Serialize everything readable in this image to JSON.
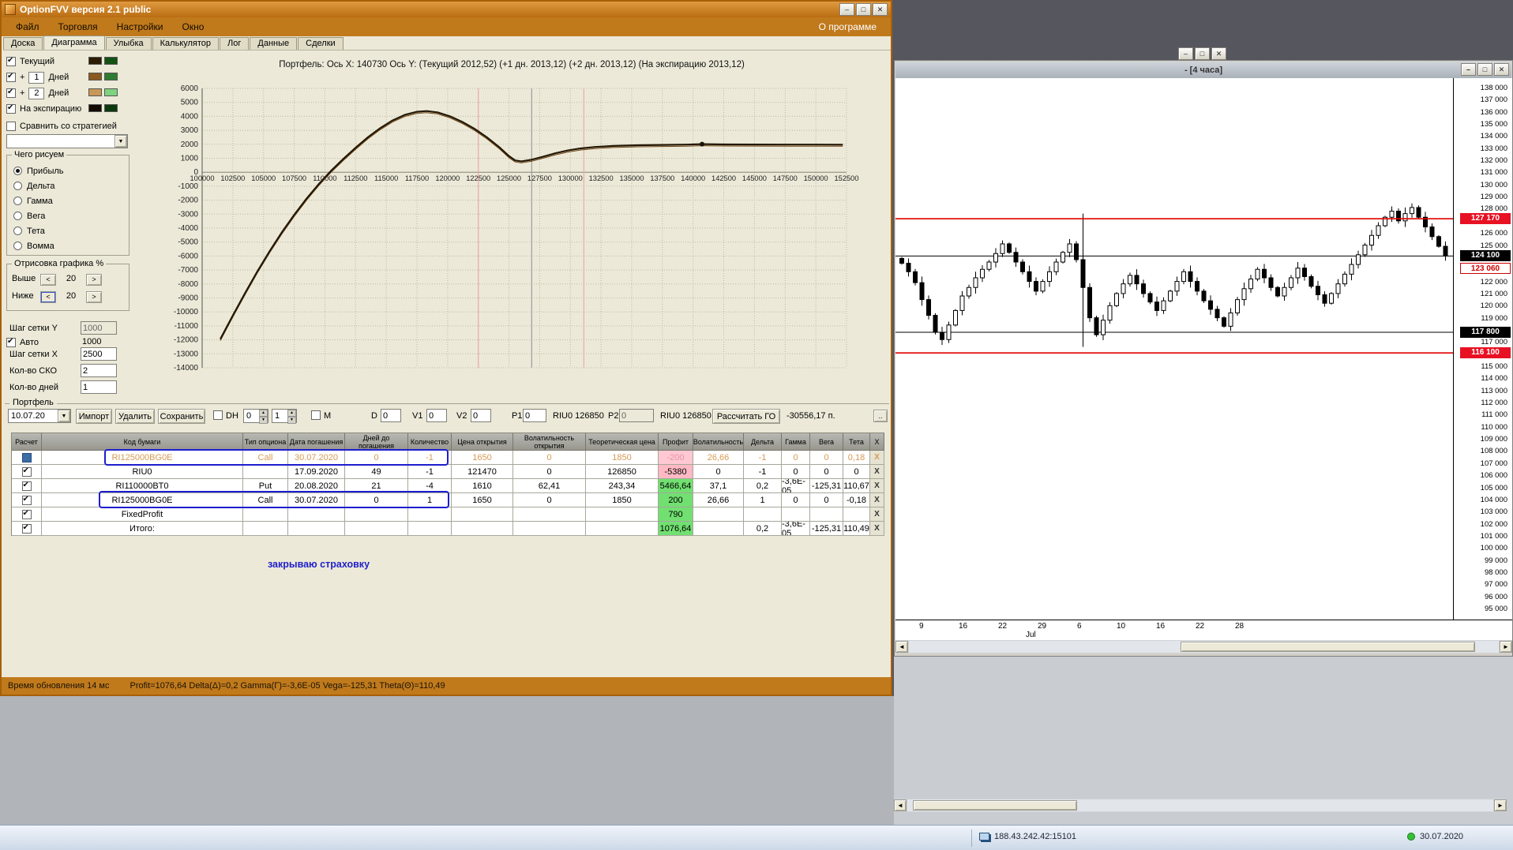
{
  "app": {
    "title": "OptionFVV версия 2.1 public",
    "menu": [
      "Файл",
      "Торговля",
      "Настройки",
      "Окно"
    ],
    "menu_right": "О программе",
    "tabs": [
      "Доска",
      "Диаграмма",
      "Улыбка",
      "Калькулятор",
      "Лог",
      "Данные",
      "Сделки"
    ],
    "active_tab": "Диаграмма"
  },
  "icons": {
    "minimize": "–",
    "maximize": "□",
    "close": "✕",
    "dropdown": "▼",
    "spin_up": "▲",
    "spin_down": "▼",
    "scroll_left": "◄",
    "scroll_right": "►",
    "step_left": "<",
    "step_right": ">"
  },
  "sidebar": {
    "legend": [
      {
        "label": "Текущий",
        "checked": true,
        "swatches": [
          "#2a1c02",
          "#145214"
        ]
      },
      {
        "prefix": "+",
        "value": "1",
        "suffix": "Дней",
        "checked": true,
        "swatches": [
          "#8a5a1e",
          "#2e7d32"
        ]
      },
      {
        "prefix": "+",
        "value": "2",
        "suffix": "Дней",
        "checked": true,
        "swatches": [
          "#c89858",
          "#7fd37f"
        ]
      },
      {
        "label": "На экспирацию",
        "checked": true,
        "swatches": [
          "#140c00",
          "#0c3a0c"
        ]
      }
    ],
    "compare_label": "Сравнить со стратегией",
    "draw_group": {
      "title": "Чего рисуем",
      "options": [
        "Прибыль",
        "Дельта",
        "Гамма",
        "Вега",
        "Тета",
        "Вомма"
      ],
      "selected": "Прибыль"
    },
    "render_group": {
      "title": "Отрисовка графика %",
      "above_label": "Выше",
      "above_value": "20",
      "below_label": "Ниже",
      "below_value": "20"
    },
    "grid_settings": {
      "y_label": "Шаг сетки Y",
      "y_value": "1000",
      "auto_label": "Авто",
      "auto_value": "1000",
      "x_label": "Шаг сетки X",
      "x_value": "2500",
      "sko_label": "Кол-во СКО",
      "sko_value": "2",
      "days_label": "Кол-во дней",
      "days_value": "1"
    }
  },
  "chart_data": [
    {
      "type": "line",
      "title": "Портфель:  Ось X: 140730  Ось Y:   (Текущий 2012,52)   (+1 дн. 2013,12)  (+2 дн. 2013,12)  (На экспирацию 2013,12)",
      "xlabel": "",
      "ylabel": "",
      "xlim": [
        100000,
        152500
      ],
      "ylim": [
        -14000,
        6000
      ],
      "x_step": 2500,
      "y_step": 1000,
      "grid": true,
      "line_color": "#241806",
      "series": [
        {
          "name": "Портфель P/L",
          "points": [
            [
              101480,
              -11950
            ],
            [
              102500,
              -10250
            ],
            [
              103500,
              -8650
            ],
            [
              104500,
              -7100
            ],
            [
              105500,
              -5650
            ],
            [
              106500,
              -4300
            ],
            [
              107500,
              -3050
            ],
            [
              108500,
              -1900
            ],
            [
              109500,
              -850
            ],
            [
              110500,
              100
            ],
            [
              111500,
              950
            ],
            [
              112500,
              1750
            ],
            [
              113500,
              2500
            ],
            [
              114500,
              3150
            ],
            [
              115500,
              3700
            ],
            [
              116500,
              4100
            ],
            [
              117500,
              4330
            ],
            [
              118300,
              4380
            ],
            [
              119200,
              4280
            ],
            [
              120200,
              4000
            ],
            [
              121200,
              3600
            ],
            [
              122200,
              3100
            ],
            [
              123200,
              2500
            ],
            [
              124200,
              1800
            ],
            [
              125000,
              1150
            ],
            [
              125500,
              850
            ],
            [
              126000,
              780
            ],
            [
              126850,
              900
            ],
            [
              127800,
              1120
            ],
            [
              128800,
              1360
            ],
            [
              129800,
              1560
            ],
            [
              130800,
              1700
            ],
            [
              132000,
              1810
            ],
            [
              133500,
              1880
            ],
            [
              135500,
              1930
            ],
            [
              137500,
              1955
            ],
            [
              139500,
              1980
            ],
            [
              140730,
              2013
            ],
            [
              142500,
              1990
            ],
            [
              145000,
              1985
            ],
            [
              147500,
              1980
            ],
            [
              150000,
              1975
            ],
            [
              152200,
              1970
            ]
          ]
        }
      ],
      "marker": {
        "x": 140730,
        "y": 2013
      },
      "vlines": [
        {
          "x": 122500,
          "color": "#e8abab"
        },
        {
          "x": 131100,
          "color": "#e8abab"
        },
        {
          "x": 126850,
          "color": "#9b9b9b"
        }
      ]
    },
    {
      "type": "candlestick",
      "title": "4 часа",
      "ylim": [
        95000,
        138000
      ],
      "y_step": 1000,
      "x_labels": [
        "9",
        "16",
        "22",
        "29",
        "6",
        "10",
        "16",
        "22",
        "28"
      ],
      "month_label": "Jul",
      "red_lines": [
        127170,
        116100
      ],
      "black_lines": [
        124100,
        117800
      ],
      "separator_index": 27,
      "closes": [
        123500,
        122800,
        121900,
        120500,
        119200,
        117800,
        117200,
        118400,
        119600,
        120800,
        121500,
        122300,
        123000,
        123600,
        124300,
        125100,
        124400,
        123600,
        122800,
        122000,
        121200,
        122000,
        122800,
        123600,
        124400,
        125100,
        123800,
        121500,
        119000,
        117600,
        118800,
        120000,
        121000,
        121800,
        122500,
        121800,
        121000,
        120300,
        119600,
        120400,
        121200,
        122000,
        122800,
        122000,
        121200,
        120400,
        119700,
        119000,
        118300,
        119400,
        120500,
        121400,
        122200,
        123000,
        122300,
        121500,
        120800,
        121500,
        122300,
        123100,
        122400,
        121600,
        120900,
        120200,
        121000,
        121800,
        122600,
        123400,
        124200,
        125000,
        125800,
        126600,
        127300,
        127800,
        127000,
        127600,
        128100,
        127300,
        126500,
        125700,
        124900,
        124100
      ]
    }
  ],
  "portfolio": {
    "label": "Портфель",
    "date_select": "10.07.20",
    "buttons": [
      "Импорт",
      "Удалить",
      "Сохранить"
    ],
    "dh_label": "DH",
    "dh_spin1": "0",
    "dh_spin2": "1",
    "m_label": "M",
    "d_label": "D",
    "d_value": "0",
    "v1_label": "V1",
    "v1_value": "0",
    "v2_label": "V2",
    "v2_value": "0",
    "p1_label": "P1",
    "p1_value": "0",
    "riu0_left": "RIU0 126850",
    "p2_label": "P2",
    "p2_value": "0",
    "riu0_right": "RIU0 126850",
    "calc_button": "Рассчитать ГО",
    "go_value": "-30556,17 п.",
    "more_button": ".."
  },
  "table": {
    "headers": [
      "Расчет",
      "Код бумаги",
      "Тип опциона",
      "Дата погашения",
      "Дней до погашения",
      "Количество",
      "Цена открытия",
      "Волатильность открытия",
      "Теоретическая цена",
      "Профит",
      "Волатильность",
      "Дельта",
      "Гамма",
      "Вега",
      "Тета",
      "X"
    ],
    "delete_label": "X",
    "rows": [
      {
        "check": "selected",
        "dim": true,
        "cells": [
          "RI125000BG0E",
          "Call",
          "30.07.2020",
          "0",
          "-1",
          "1650",
          "0",
          "1850",
          "-200",
          "26,66",
          "-1",
          "0",
          "0",
          "0,18"
        ]
      },
      {
        "check": "checked",
        "dim": false,
        "cells": [
          "RIU0",
          "",
          "17.09.2020",
          "49",
          "-1",
          "121470",
          "0",
          "126850",
          "-5380",
          "0",
          "-1",
          "0",
          "0",
          "0"
        ]
      },
      {
        "check": "checked",
        "dim": false,
        "cells": [
          "RI110000BT0",
          "Put",
          "20.08.2020",
          "21",
          "-4",
          "1610",
          "62,41",
          "243,34",
          "5466,64",
          "37,1",
          "0,2",
          "-3,6E-05",
          "-125,31",
          "110,67"
        ]
      },
      {
        "check": "checked",
        "dim": false,
        "cells": [
          "RI125000BG0E",
          "Call",
          "30.07.2020",
          "0",
          "1",
          "1650",
          "0",
          "1850",
          "200",
          "26,66",
          "1",
          "0",
          "0",
          "-0,18"
        ]
      },
      {
        "check": "checked",
        "dim": false,
        "cells": [
          "FixedProfit",
          "",
          "",
          "",
          "",
          "",
          "",
          "",
          "790",
          "",
          "",
          "",
          "",
          ""
        ]
      },
      {
        "check": "checked",
        "dim": false,
        "cells": [
          "Итого:",
          "",
          "",
          "",
          "",
          "",
          "",
          "",
          "1076,64",
          "",
          "0,2",
          "-3,6E-05",
          "-125,31",
          "110,49"
        ]
      }
    ]
  },
  "annotation": {
    "note": "закрываю страховку"
  },
  "statusbar": {
    "left": "Время обновления 14 мс",
    "right": "Profit=1076,64 Delta(Δ)=0,2 Gamma(Γ)=-3,6E-05 Vega=-125,31 Theta(Θ)=110,49"
  },
  "terminal": {
    "title": "- [4 часа]",
    "price_tags": [
      {
        "price": 127170,
        "style": "red"
      },
      {
        "price": 124100,
        "style": "black"
      },
      {
        "price": 123060,
        "style": "outline"
      },
      {
        "price": 117800,
        "style": "black"
      },
      {
        "price": 116100,
        "style": "red"
      }
    ]
  },
  "taskbar": {
    "ip": "188.43.242.42:15101",
    "date": "30.07.2020"
  }
}
